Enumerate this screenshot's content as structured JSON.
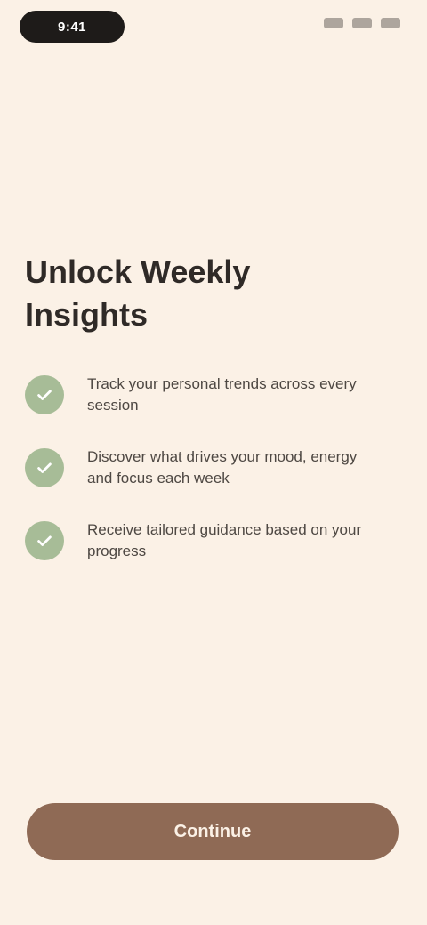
{
  "status_bar": {
    "time": "9:41"
  },
  "main": {
    "title": "Unlock Weekly Insights",
    "benefits": [
      {
        "text": "Track your personal trends across every session"
      },
      {
        "text": "Discover what drives your mood, energy and focus each week"
      },
      {
        "text": "Receive tailored guidance based on your progress"
      }
    ]
  },
  "cta": {
    "label": "Continue"
  },
  "colors": {
    "background": "#FBF1E6",
    "accent": "#8F6A55",
    "check": "#A7BC97"
  }
}
